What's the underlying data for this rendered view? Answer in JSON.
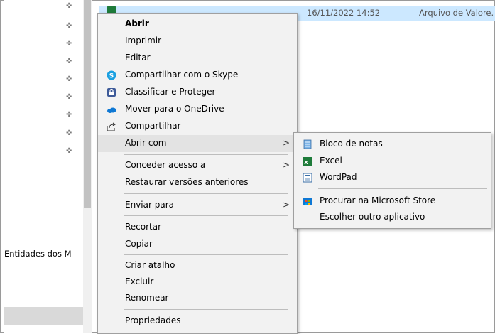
{
  "file": {
    "date": "16/11/2022 14:52",
    "type": "Arquivo de Valore."
  },
  "nav": {
    "partial_text": "Entidades dos M"
  },
  "context_menu": {
    "items": {
      "abrir": "Abrir",
      "imprimir": "Imprimir",
      "editar": "Editar",
      "skype": "Compartilhar com o Skype",
      "classificar": "Classificar e Proteger",
      "onedrive": "Mover para o OneDrive",
      "compartilhar": "Compartilhar",
      "abrir_com": "Abrir com",
      "conceder": "Conceder acesso a",
      "restaurar": "Restaurar versões anteriores",
      "enviar": "Enviar para",
      "recortar": "Recortar",
      "copiar": "Copiar",
      "criar_atalho": "Criar atalho",
      "excluir": "Excluir",
      "renomear": "Renomear",
      "propriedades": "Propriedades"
    },
    "submenu_arrow": ">"
  },
  "submenu": {
    "items": {
      "bloco": "Bloco de notas",
      "excel": "Excel",
      "wordpad": "WordPad",
      "store": "Procurar na Microsoft Store",
      "outro": "Escolher outro aplicativo"
    }
  },
  "colors": {
    "selection": "#cce8ff",
    "menu_bg": "#f2f2f2",
    "skype": "#1ba0e1",
    "onedrive": "#0f78d4",
    "excel": "#1e7b3a"
  }
}
